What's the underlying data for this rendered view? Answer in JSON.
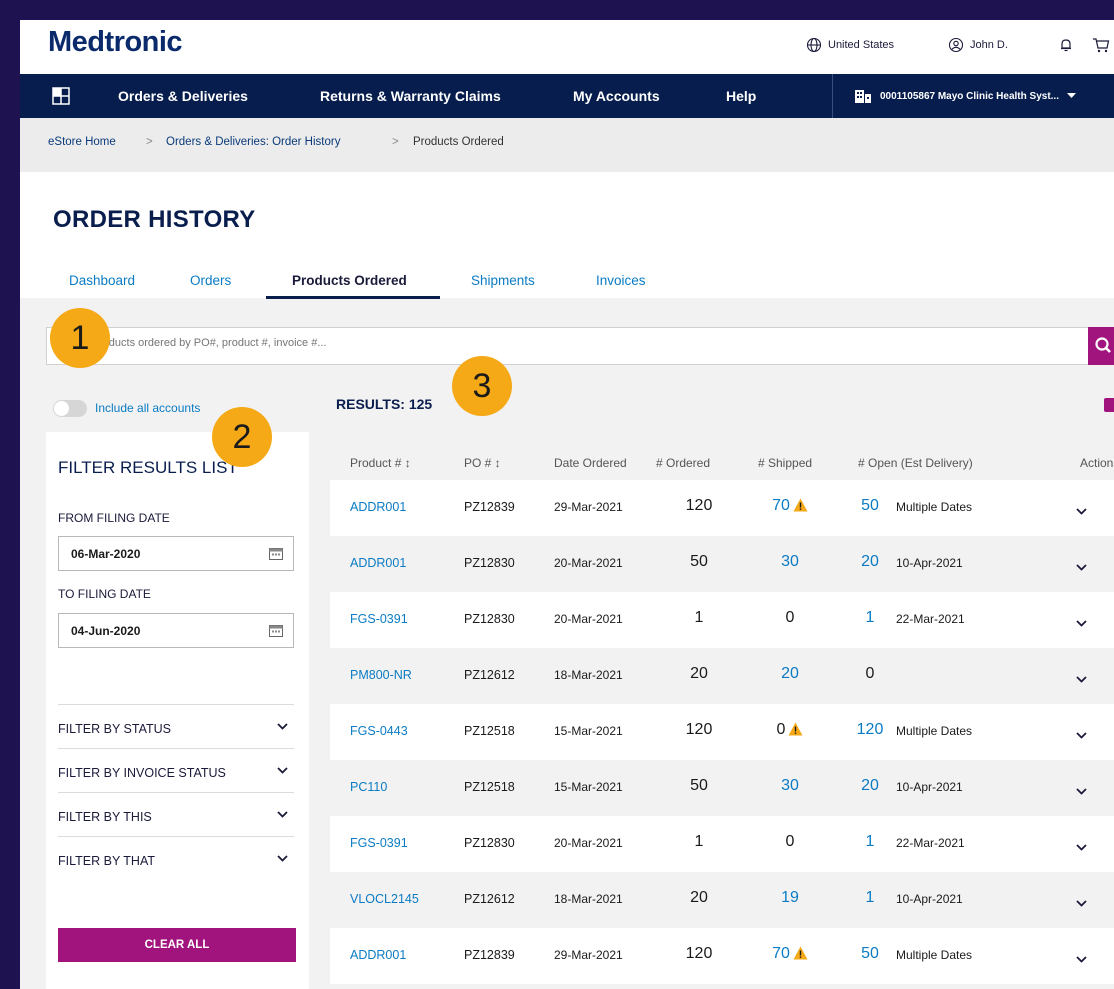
{
  "header": {
    "logo": "Medtronic",
    "country": "United States",
    "user": "John D."
  },
  "nav": {
    "items": [
      "Orders & Deliveries",
      "Returns & Warranty Claims",
      "My Accounts",
      "Help"
    ],
    "account": "0001105867 Mayo Clinic Health Syst..."
  },
  "breadcrumb": {
    "items": [
      "eStore Home",
      "Orders & Deliveries: Order History",
      "Products Ordered"
    ],
    "separator": ">"
  },
  "page": {
    "title": "ORDER HISTORY",
    "tabs": [
      "Dashboard",
      "Orders",
      "Products Ordered",
      "Shipments",
      "Invoices"
    ],
    "active_tab": "Products Ordered"
  },
  "search": {
    "placeholder": "Search products ordered by PO#, product #, invoice #..."
  },
  "markers": [
    "1",
    "2",
    "3"
  ],
  "toggle": {
    "label": "Include all accounts",
    "on": false
  },
  "filters": {
    "title": "FILTER RESULTS LIST",
    "from_label": "FROM FILING DATE",
    "from_value": "06-Mar-2020",
    "to_label": "TO FILING DATE",
    "to_value": "04-Jun-2020",
    "sections": [
      "FILTER BY STATUS",
      "FILTER BY INVOICE STATUS",
      "FILTER BY THIS",
      "FILTER BY THAT"
    ],
    "clear_label": "CLEAR ALL"
  },
  "results": {
    "label": "RESULTS: 125"
  },
  "table": {
    "headers": [
      "Product # ↕",
      "PO # ↕",
      "Date Ordered",
      "# Ordered",
      "# Shipped",
      "# Open (Est Delivery)",
      "Actions"
    ],
    "rows": [
      {
        "product": "ADDR001",
        "po": "PZ12839",
        "date": "29-Mar-2021",
        "ordered": "120",
        "shipped": "70",
        "warn": true,
        "open": "50",
        "est": "Multiple Dates"
      },
      {
        "product": "ADDR001",
        "po": "PZ12830",
        "date": "20-Mar-2021",
        "ordered": "50",
        "shipped": "30",
        "warn": false,
        "open": "20",
        "est": "10-Apr-2021"
      },
      {
        "product": "FGS-0391",
        "po": "PZ12830",
        "date": "20-Mar-2021",
        "ordered": "1",
        "shipped": "0",
        "warn": false,
        "open": "1",
        "est": "22-Mar-2021"
      },
      {
        "product": "PM800-NR",
        "po": "PZ12612",
        "date": "18-Mar-2021",
        "ordered": "20",
        "shipped": "20",
        "warn": false,
        "open": "0",
        "est": ""
      },
      {
        "product": "FGS-0443",
        "po": "PZ12518",
        "date": "15-Mar-2021",
        "ordered": "120",
        "shipped": "0",
        "warn": true,
        "open": "120",
        "est": "Multiple Dates"
      },
      {
        "product": "PC110",
        "po": "PZ12518",
        "date": "15-Mar-2021",
        "ordered": "50",
        "shipped": "30",
        "warn": false,
        "open": "20",
        "est": "10-Apr-2021"
      },
      {
        "product": "FGS-0391",
        "po": "PZ12830",
        "date": "20-Mar-2021",
        "ordered": "1",
        "shipped": "0",
        "warn": false,
        "open": "1",
        "est": "22-Mar-2021"
      },
      {
        "product": "VLOCL2145",
        "po": "PZ12612",
        "date": "18-Mar-2021",
        "ordered": "20",
        "shipped": "19",
        "warn": false,
        "open": "1",
        "est": "10-Apr-2021"
      },
      {
        "product": "ADDR001",
        "po": "PZ12839",
        "date": "29-Mar-2021",
        "ordered": "120",
        "shipped": "70",
        "warn": true,
        "open": "50",
        "est": "Multiple Dates"
      }
    ]
  },
  "colors": {
    "brand_navy": "#061d4e",
    "accent_magenta": "#a1147e",
    "link_blue": "#0a7bc4",
    "warning": "#f5a916",
    "backdrop": "#1e1350"
  },
  "icons": [
    "globe-icon",
    "user-icon",
    "bell-icon",
    "cart-icon",
    "grid-icon",
    "building-icon",
    "search-icon",
    "calendar-icon",
    "chevron-down-icon",
    "more-vertical-icon",
    "warning-icon",
    "print-icon"
  ]
}
